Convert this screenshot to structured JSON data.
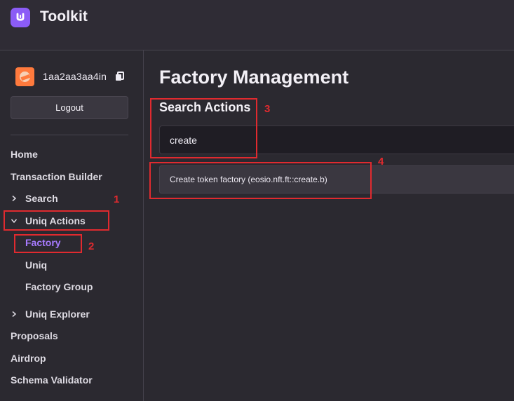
{
  "app": {
    "name": "Toolkit",
    "accent": "#8b5cf6",
    "active_color": "#a77bff",
    "annotation_color": "#e02a2f"
  },
  "header": {
    "logo_icon": "unique-logo-icon",
    "title": "Toolkit"
  },
  "account": {
    "avatar_icon": "avatar-icon",
    "username": "1aa2aa3aa4in",
    "copy_icon": "copy-icon",
    "logout_label": "Logout"
  },
  "sidebar": {
    "items": [
      {
        "label": "Home"
      },
      {
        "label": "Transaction Builder"
      },
      {
        "label": "Search",
        "icon": "chevron-right-icon"
      },
      {
        "label": "Uniq Actions",
        "icon": "chevron-down-icon"
      },
      {
        "label": "Factory",
        "active": true
      },
      {
        "label": "Uniq"
      },
      {
        "label": "Factory Group"
      },
      {
        "label": "Uniq Explorer",
        "icon": "chevron-right-icon"
      },
      {
        "label": "Proposals"
      },
      {
        "label": "Airdrop"
      },
      {
        "label": "Schema Validator"
      }
    ]
  },
  "main": {
    "page_title": "Factory Management",
    "section_title": "Search Actions",
    "search": {
      "value": "create",
      "placeholder": ""
    },
    "results": [
      {
        "label": "Create token factory (eosio.nft.ft::create.b)"
      }
    ]
  },
  "annotations": [
    {
      "number": "1"
    },
    {
      "number": "2"
    },
    {
      "number": "3"
    },
    {
      "number": "4"
    }
  ]
}
